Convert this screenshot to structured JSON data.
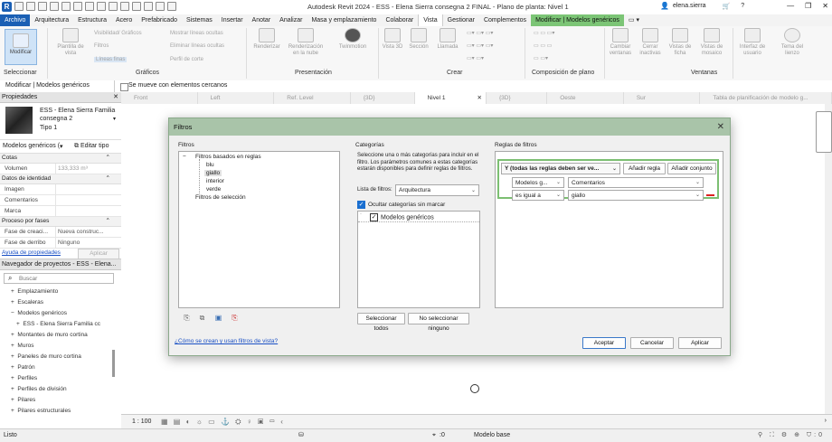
{
  "window": {
    "title": "Autodesk Revit 2024 - ESS - Elena Sierra consegna 2 FINAL - Plano de planta: Nivel 1",
    "user": "elena.sierra",
    "logo": "R"
  },
  "ribbon_tabs": [
    "Archivo",
    "Arquitectura",
    "Estructura",
    "Acero",
    "Prefabricado",
    "Sistemas",
    "Insertar",
    "Anotar",
    "Analizar",
    "Masa y emplazamiento",
    "Colaborar",
    "Vista",
    "Gestionar",
    "Complementos",
    "Modificar | Modelos genéricos"
  ],
  "ribbon": {
    "modify": "Modificar",
    "plantilla": "Plantilla de vista",
    "visibility": "Visibilidad/ Gráficos",
    "filters": "Filtros",
    "thin_lines": "Líneas finas",
    "show_hidden": "Mostrar líneas ocultas",
    "remove_hidden": "Eliminar líneas ocultas",
    "cut_profile": "Perfil de corte",
    "render": "Renderizar",
    "render_cloud": "Renderización en la nube",
    "walkthrough": "Twinmotion",
    "view3d": "Vista 3D",
    "section": "Sección",
    "callout": "Llamada",
    "switch_windows": "Cambiar ventanas",
    "close_inactive": "Cerrar inactivas",
    "tile_views": "Vistas de ficha",
    "tab_views": "Vistas de mosaico",
    "ui": "Interfaz de usuario",
    "theme": "Tema del lienzo",
    "groups": {
      "select": "Seleccionar",
      "graphics": "Gráficos",
      "presentation": "Presentación",
      "create": "Crear",
      "sheet_comp": "Composición de plano",
      "windows": "Ventanas"
    }
  },
  "context_bar": {
    "label": "Modificar | Modelos genéricos",
    "checkbox": "Se mueve con elementos cercanos"
  },
  "properties": {
    "header": "Propiedades",
    "type_name": "ESS - Elena Sierra Familia consegna 2",
    "type_sub": "Tipo 1",
    "selector": "Modelos genéricos (",
    "edit_type": "Editar tipo",
    "groups": [
      {
        "name": "Cotas",
        "rows": [
          {
            "k": "Volumen",
            "v": "133,333 m³"
          }
        ]
      },
      {
        "name": "Datos de identidad",
        "rows": [
          {
            "k": "Imagen",
            "v": ""
          },
          {
            "k": "Comentarios",
            "v": ""
          },
          {
            "k": "Marca",
            "v": ""
          }
        ]
      },
      {
        "name": "Proceso por fases",
        "rows": [
          {
            "k": "Fase de creaci...",
            "v": "Nueva construc..."
          },
          {
            "k": "Fase de derribo",
            "v": "Ninguno"
          }
        ]
      }
    ],
    "help_link": "Ayuda de propiedades",
    "apply": "Aplicar"
  },
  "browser": {
    "header": "Navegador de proyectos - ESS - Elena...",
    "search_placeholder": "Buscar",
    "items": [
      {
        "label": "Emplazamiento",
        "sign": "+",
        "indent": 1
      },
      {
        "label": "Escaleras",
        "sign": "+",
        "indent": 1
      },
      {
        "label": "Modelos genéricos",
        "sign": "−",
        "indent": 1
      },
      {
        "label": "ESS - Elena Sierra Familia cc",
        "sign": "+",
        "indent": 2
      },
      {
        "label": "Montantes de muro cortina",
        "sign": "+",
        "indent": 1
      },
      {
        "label": "Muros",
        "sign": "+",
        "indent": 1
      },
      {
        "label": "Paneles de muro cortina",
        "sign": "+",
        "indent": 1
      },
      {
        "label": "Patrón",
        "sign": "+",
        "indent": 1
      },
      {
        "label": "Perfiles",
        "sign": "+",
        "indent": 1
      },
      {
        "label": "Perfiles de división",
        "sign": "+",
        "indent": 1
      },
      {
        "label": "Pilares",
        "sign": "+",
        "indent": 1
      },
      {
        "label": "Pilares estructurales",
        "sign": "+",
        "indent": 1
      }
    ]
  },
  "view_tabs": [
    "Front",
    "Left",
    "Ref. Level",
    "{3D}",
    "Nivel 1",
    "{3D}",
    "Oeste",
    "Sur",
    "Tabla de planificación de modelo g..."
  ],
  "active_view_tab": 4,
  "view_control": {
    "scale": "1 : 100"
  },
  "status": {
    "left": "Listo",
    "model": "Modelo base",
    "zero": ":0"
  },
  "dialog": {
    "title": "Filtros",
    "filters_label": "Filtros",
    "rule_based": "Filtros basados en reglas",
    "rule_children": [
      "blu",
      "giallo",
      "interior",
      "verde"
    ],
    "selected_child": "giallo",
    "selection_filters": "Filtros de selección",
    "categories_label": "Categorías",
    "categories_desc": "Seleccione una o más categorías para incluir en el filtro. Los parámetros comunes a estas categorías estarán disponibles para definir reglas de filtros.",
    "list_label": "Lista de filtros:",
    "list_value": "Arquitectura",
    "hide_unchecked": "Ocultar categorías sin marcar",
    "category_item": "Modelos genéricos",
    "select_all": "Seleccionar todos",
    "select_none": "No seleccionar ninguno",
    "rules_label": "Reglas de filtros",
    "and_rule": "Y (todas las reglas deben ser ve...",
    "add_rule": "Añadir regla",
    "add_set": "Añadir conjunto",
    "rule_category": "Modelos g...",
    "rule_param": "Comentarios",
    "rule_op": "es igual a",
    "rule_value": "giallo",
    "help_link": "¿Cómo se crean y usan filtros de vista?",
    "ok": "Aceptar",
    "cancel": "Cancelar",
    "apply": "Aplicar"
  }
}
